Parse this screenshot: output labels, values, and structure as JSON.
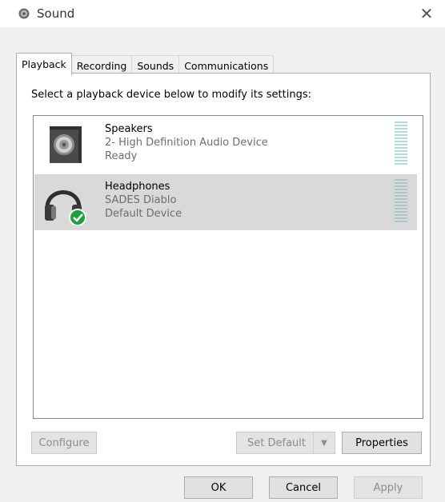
{
  "window": {
    "title": "Sound",
    "close_label": "✕"
  },
  "tabs": [
    {
      "label": "Playback",
      "active": true
    },
    {
      "label": "Recording",
      "active": false
    },
    {
      "label": "Sounds",
      "active": false
    },
    {
      "label": "Communications",
      "active": false
    }
  ],
  "playback": {
    "instruction": "Select a playback device below to modify its settings:",
    "devices": [
      {
        "name": "Speakers",
        "description": "2- High Definition Audio Device",
        "status": "Ready",
        "icon": "speaker-icon",
        "default": false,
        "selected": false
      },
      {
        "name": "Headphones",
        "description": "SADES Diablo",
        "status": "Default Device",
        "icon": "headphones-icon",
        "default": true,
        "selected": true
      }
    ]
  },
  "buttons": {
    "configure": "Configure",
    "set_default": "Set Default",
    "properties": "Properties",
    "ok": "OK",
    "cancel": "Cancel",
    "apply": "Apply"
  },
  "colors": {
    "selection": "#d9d9d9",
    "default_check": "#1e9e3c",
    "level_meter": "#b7d9d8"
  }
}
